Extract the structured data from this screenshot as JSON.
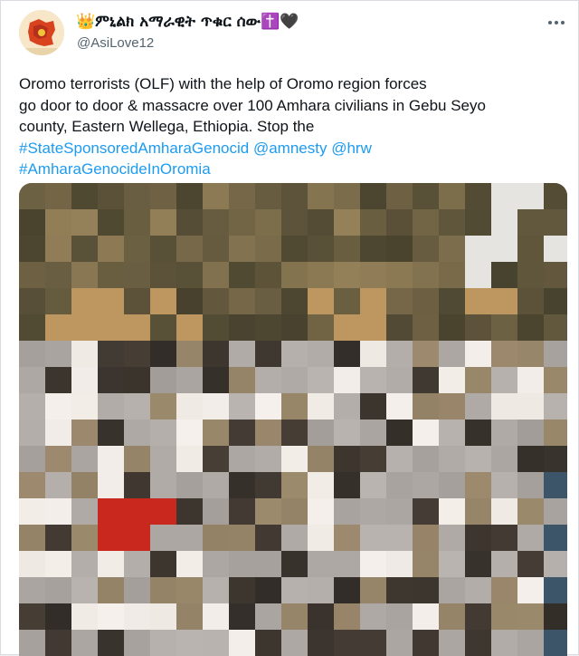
{
  "author": {
    "display_name": "👑ምኒልክ አማራዊት ጥቁር ሰው✝️🖤",
    "handle": "@AsiLove12"
  },
  "tweet": {
    "line1": "Oromo terrorists (OLF) with the help of Oromo region forces",
    "line2": "go door to door & massacre over 100 Amhara civilians in Gebu Seyo",
    "line3": "county, Eastern Wellega, Ethiopia. Stop the",
    "hashtag1": "#StateSponsoredAmharaGenocid",
    "mention1": "@amnesty",
    "mention2": "@hrw",
    "hashtag2": "#AmharaGenocideInOromia"
  },
  "media": {
    "description": "pixelated photo",
    "colors": [
      "#6f6250",
      "#8a7a5e",
      "#b8ab92",
      "#d8cfc2",
      "#4a4236",
      "#a03a2a",
      "#3c4a56"
    ]
  },
  "colors": {
    "link": "#1d9bf0",
    "text": "#0f1419",
    "secondary": "#536471"
  }
}
